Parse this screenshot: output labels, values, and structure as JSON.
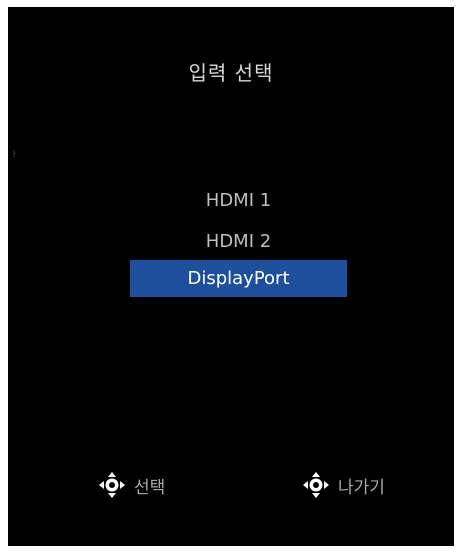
{
  "stray_text": "ᅡ",
  "title": "입력 선택",
  "menu": {
    "items": [
      {
        "label": "HDMI 1",
        "selected": false
      },
      {
        "label": "HDMI 2",
        "selected": false
      },
      {
        "label": "DisplayPort",
        "selected": true
      }
    ]
  },
  "footer": {
    "select_label": "선택",
    "exit_label": "나가기"
  },
  "colors": {
    "background": "#000000",
    "highlight": "#1d4f9d",
    "text": "#bfbfbf"
  },
  "icons": {
    "select_icon": "joystick-nav-icon",
    "exit_icon": "joystick-nav-icon"
  }
}
